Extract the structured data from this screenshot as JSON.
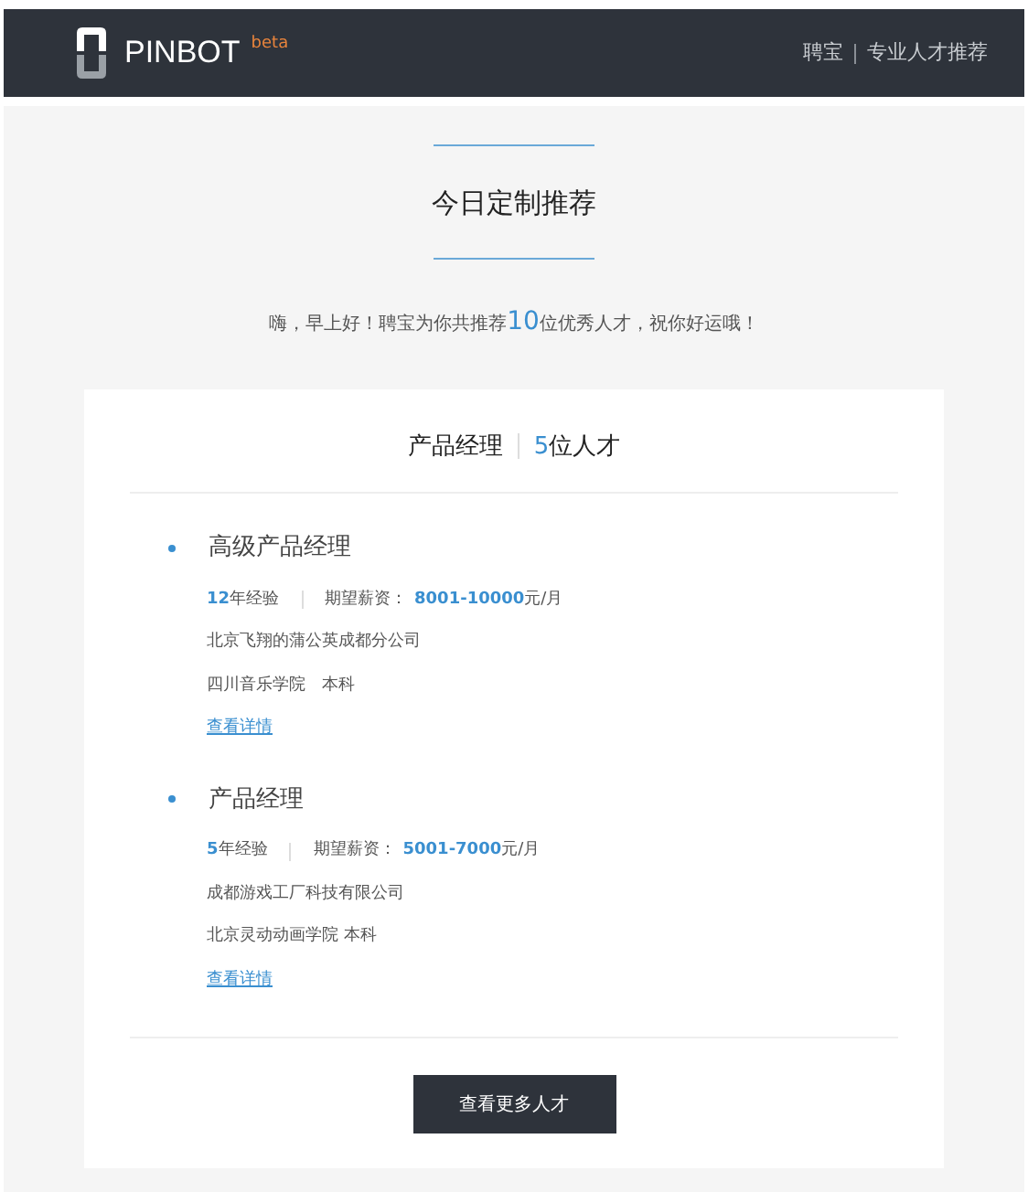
{
  "header": {
    "brand": "PINBOT",
    "badge": "beta",
    "links": [
      "聘宝",
      "专业人才推荐"
    ]
  },
  "title": "今日定制推荐",
  "greeting": {
    "before": "嗨，早上好！聘宝为你共推荐",
    "count": "10",
    "after": "位优秀人才，祝你好运哦！"
  },
  "card": {
    "position": "产品经理",
    "count": "5",
    "count_unit": "位人才",
    "candidates": [
      {
        "title": "高级产品经理",
        "years": "12",
        "years_unit": "年经验",
        "salary_label": "期望薪资：",
        "salary": "8001-10000",
        "salary_unit": "元/月",
        "company": "北京飞翔的蒲公英成都分公司",
        "education": "四川音乐学院　本科",
        "link": "查看详情"
      },
      {
        "title": "产品经理",
        "years": "5",
        "years_unit": "年经验",
        "salary_label": "期望薪资：",
        "salary": "5001-7000",
        "salary_unit": "元/月",
        "company": "成都游戏工厂科技有限公司",
        "education": "北京灵动动画学院 本科",
        "link": "查看详情"
      }
    ],
    "button": "查看更多人才"
  }
}
